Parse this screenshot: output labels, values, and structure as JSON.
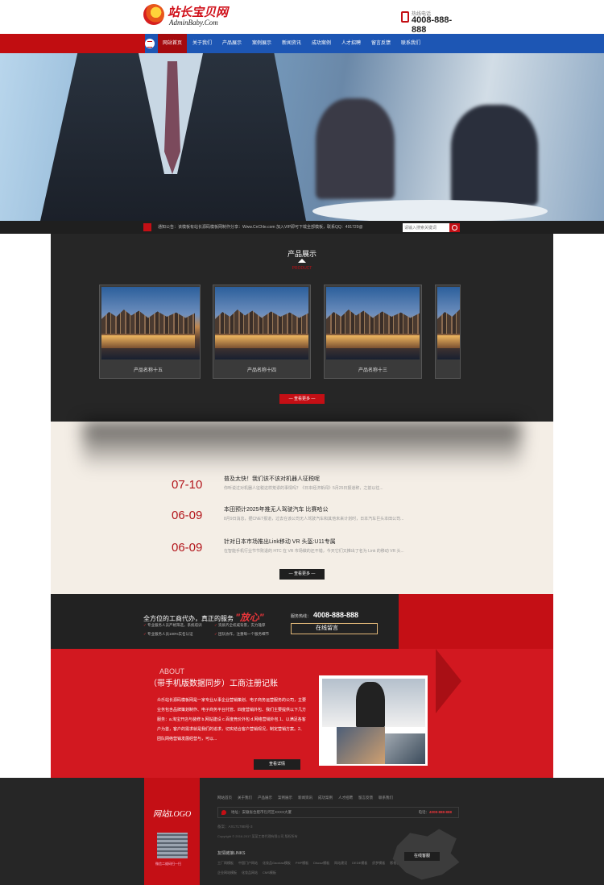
{
  "header": {
    "logo_title": "站长宝贝网",
    "logo_subtitle": "AdminBaby.Com",
    "hotline_label": "热线电话",
    "hotline_number": "4008-888-888"
  },
  "nav": {
    "items": [
      "网站首页",
      "关于我们",
      "产品展示",
      "案例展示",
      "新闻资讯",
      "成功案例",
      "人才招聘",
      "留言反馈",
      "联系我们"
    ]
  },
  "notice": {
    "text": "通知公告：该模板有站长源码模板网制作分享：Www.CnChle.com 加入VIP即可下载全部模板，联系QQ：491729@",
    "search_placeholder": "请输入搜索关键词"
  },
  "products": {
    "title": "产品展示",
    "subtitle": "PRODUCT",
    "items": [
      "产品名称十五",
      "产品名称十四",
      "产品名称十三"
    ],
    "more": "— 查看更多 —"
  },
  "news": {
    "items": [
      {
        "date": "07-10",
        "title": "普及太快！我们该不该对机器人征税呢",
        "desc": "你听说过对机器人征税这样荒谬的事情吗？《日本经济新闻》5月25日报道称，之前以往..."
      },
      {
        "date": "06-09",
        "title": "本田预计2025年推无人驾驶汽车 比赛哈公",
        "desc": "8月9日消息，据CNET报道，过去在该公司无人驾驶汽车和其他未来计划时，日本汽车巨头本田公司..."
      },
      {
        "date": "06-09",
        "title": "针对日本市场推出Link移动 VR 头盔:U11专属",
        "desc": "在智能手机行业节节败退的 HTC 在 VR 市场做的还不错，今天它们又推出了名为 Link 的移动 VR 头..."
      }
    ],
    "more": "— 查看更多 —"
  },
  "service": {
    "headline": "全方位的工商代办，真正的服务",
    "highlight": "\"放心\"",
    "points": [
      "专业服务人员严格筛选，系统培训",
      "资质齐全权威背景，实力雄厚",
      "专业服务人员100%实名认证",
      "团队协作，注重每一个服务细节"
    ],
    "hotline_label": "服务热线：",
    "hotline_number": "4008-888-888",
    "button": "在线留言"
  },
  "about": {
    "tag": "ABOUT",
    "title": "（带手机版数据同步）工商注册记账",
    "desc": "众乐站长源码模板网是一家专业从事企业营销策划、电子商务运营服务的公司，主要业务包含品牌策划制作、电子商务平台托管、四度营销外包、我们主要提供以下几方服务：a.淘宝开店与装修 b.网站建设 c.百度竞价外包 d.网络营销外包 1、以满足各客户为首，客户的需求就是我们的追求，切实结合客户营销现况，制定营销方案。2、团队网络营销发展经营与，可以...",
    "more": "查看详情"
  },
  "footer": {
    "logo": "网站LOGO",
    "qr_caption": "微信二维码扫一扫",
    "links": [
      "网站首页",
      "关于我们",
      "产品展示",
      "案例展示",
      "新闻资讯",
      "成功案例",
      "人才招聘",
      "留言反馈",
      "联系我们"
    ],
    "address": "地址：安徽省合肥市包河区XXXX大厦",
    "phone_label": "电话：",
    "phone": "4008-888-888",
    "icp": "备案：AX17178B号-3",
    "copyright": "Copyright © 2016-2017 某某工商代理有限公司 版权所有",
    "friend_label": "友情链接LINKS",
    "friend_links": [
      "工厂网模板",
      "中国门户网站",
      "化妆品Gaoxiao模板",
      "PHP模板",
      "Discuz模板",
      "网站建设",
      "DEDE模板",
      "织梦模板",
      "影视模板",
      "娱乐新闻",
      "DB模板网",
      "站长网",
      "企业网站模板",
      "化妆品网站",
      "CMS模板"
    ],
    "online_button": "在线客服"
  }
}
